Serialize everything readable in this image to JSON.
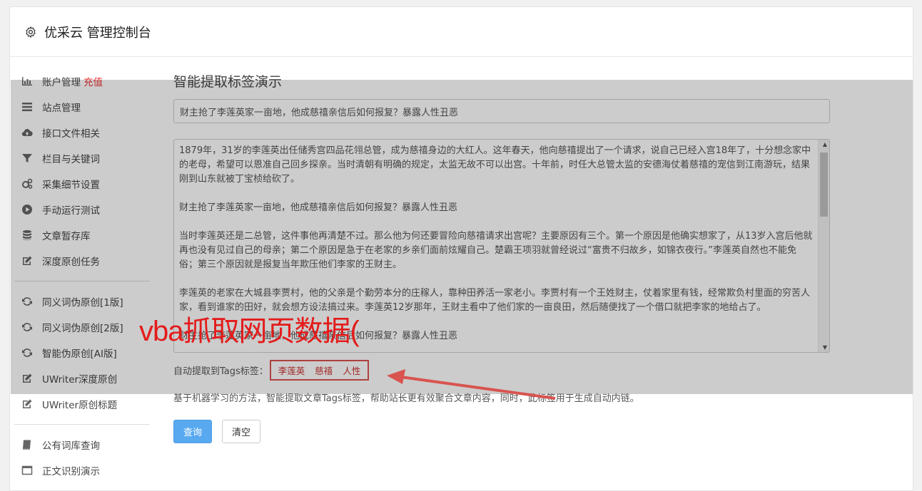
{
  "header": {
    "title": "优采云 管理控制台",
    "icon": "gear-icon"
  },
  "sidebar": {
    "group1": [
      {
        "label": "账户管理",
        "badge": "充值",
        "icon": "bar-chart-icon"
      },
      {
        "label": "站点管理",
        "icon": "list-icon"
      },
      {
        "label": "接口文件相关",
        "icon": "cloud-upload-icon"
      },
      {
        "label": "栏目与关键词",
        "icon": "filter-icon"
      },
      {
        "label": "采集细节设置",
        "icon": "cogs-icon"
      },
      {
        "label": "手动运行测试",
        "icon": "play-circle-icon"
      },
      {
        "label": "文章暂存库",
        "icon": "database-icon"
      },
      {
        "label": "深度原创任务",
        "icon": "edit-icon"
      }
    ],
    "group2": [
      {
        "label": "同义词伪原创[1版]",
        "icon": "refresh-icon"
      },
      {
        "label": "同义词伪原创[2版]",
        "icon": "refresh-icon"
      },
      {
        "label": "智能伪原创[AI版]",
        "icon": "refresh-icon"
      },
      {
        "label": "UWriter深度原创",
        "icon": "edit-icon"
      },
      {
        "label": "UWriter原创标题",
        "icon": "edit-icon"
      }
    ],
    "group3": [
      {
        "label": "公有词库查询",
        "icon": "book-icon"
      },
      {
        "label": "正文识别演示",
        "icon": "window-icon"
      }
    ]
  },
  "main": {
    "heading": "智能提取标签演示",
    "title_value": "财主抢了李莲英家一亩地，他成慈禧亲信后如何报复？暴露人性丑恶",
    "content_paragraphs": [
      "1879年，31岁的李莲英出任储秀宫四品花翎总管，成为慈禧身边的大红人。这年春天，他向慈禧提出了一个请求，说自己已经入宫18年了，十分想念家中的老母，希望可以恩准自己回乡探亲。当时清朝有明确的规定，太监无故不可以出宫。十年前，时任大总管太监的安德海仗着慈禧的宠信到江南游玩，结果刚到山东就被丁宝桢给砍了。",
      "财主抢了李莲英家一亩地，他成慈禧亲信后如何报复？暴露人性丑恶",
      "当时李莲英还是二总管，这件事他再清楚不过。那么他为何还要冒险向慈禧请求出宫呢？主要原因有三个。第一个原因是他确实想家了，从13岁入宫后他就再也没有见过自己的母亲；第二个原因是急于在老家的乡亲们面前炫耀自己。楚霸王项羽就曾经说过“富贵不归故乡，如锦衣夜行。”李莲英自然也不能免俗；第三个原因就是报复当年欺压他们李家的王财主。",
      "李莲英的老家在大城县李贾村，他的父亲是个勤劳本分的庄稼人，靠种田养活一家老小。李贾村有一个王姓财主，仗着家里有钱，经常欺负村里面的穷苦人家，看到谁家的田好，就会想方设法搞过来。李莲英12岁那年，王财主看中了他们家的一亩良田，然后随便找了一个借口就把李家的地给占了。",
      "财主抢了李莲英家一亩地，他成慈禧亲信后如何报复？暴露人性丑恶"
    ],
    "tags_label": "自动提取到Tags标签：",
    "tags": [
      "李莲英",
      "慈禧",
      "人性"
    ],
    "description": "基于机器学习的方法，智能提取文章Tags标签，帮助站长更有效聚合文章内容，同时，此标签用于生成自动内链。",
    "query_button": "查询",
    "clear_button": "清空"
  },
  "overlay": {
    "caption": "vba抓取网页数据(",
    "caption_color": "#e41b1b",
    "arrow_color": "#d9534f"
  }
}
